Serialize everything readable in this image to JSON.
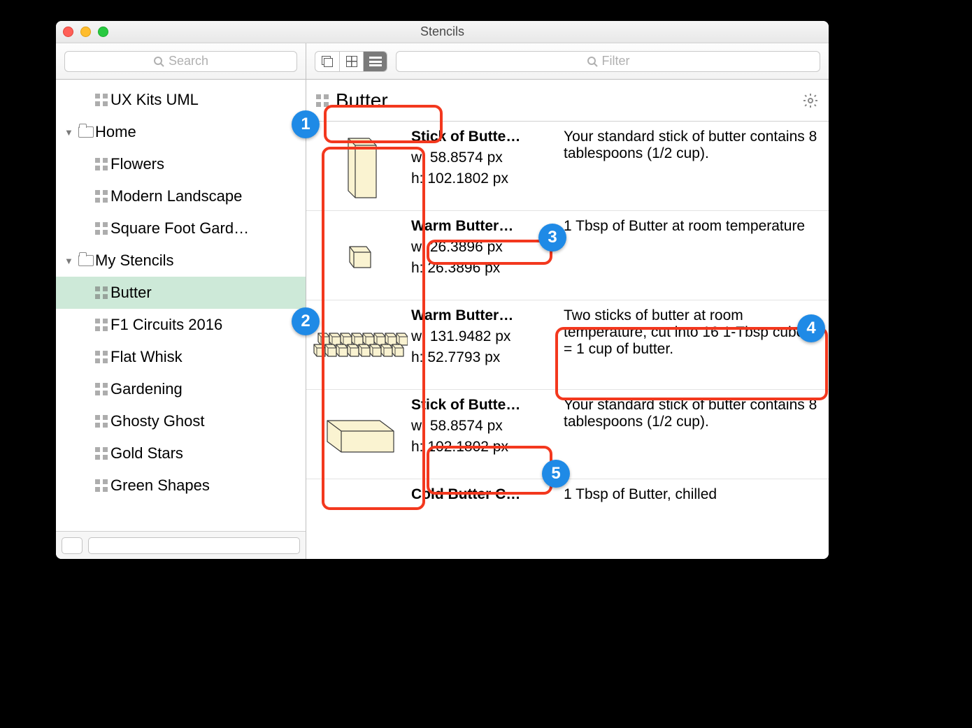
{
  "window": {
    "title": "Stencils"
  },
  "toolbar": {
    "search_placeholder": "Search",
    "filter_placeholder": "Filter"
  },
  "sidebar": {
    "nodes": [
      {
        "label": "UX Kits UML",
        "depth": 2,
        "icon": "grid",
        "selected": false
      },
      {
        "label": "Home",
        "depth": 1,
        "icon": "folder",
        "expanded": true
      },
      {
        "label": "Flowers",
        "depth": 2,
        "icon": "grid"
      },
      {
        "label": "Modern Landscape",
        "depth": 2,
        "icon": "grid"
      },
      {
        "label": "Square Foot Gard…",
        "depth": 2,
        "icon": "grid"
      },
      {
        "label": "My Stencils",
        "depth": 1,
        "icon": "folder",
        "expanded": true
      },
      {
        "label": "Butter",
        "depth": 2,
        "icon": "grid",
        "selected": true
      },
      {
        "label": "F1 Circuits 2016",
        "depth": 2,
        "icon": "grid"
      },
      {
        "label": "Flat Whisk",
        "depth": 2,
        "icon": "grid"
      },
      {
        "label": "Gardening",
        "depth": 2,
        "icon": "grid"
      },
      {
        "label": "Ghosty Ghost",
        "depth": 2,
        "icon": "grid"
      },
      {
        "label": "Gold Stars",
        "depth": 2,
        "icon": "grid"
      },
      {
        "label": "Green Shapes",
        "depth": 2,
        "icon": "grid"
      }
    ]
  },
  "header": {
    "title": "Butter"
  },
  "items": [
    {
      "name": "Stick of Butte…",
      "w": "w: 58.8574 px",
      "h": "h: 102.1802 px",
      "desc": "Your standard stick of butter contains 8 tablespoons (1/2 cup).",
      "thumb": "tall-box"
    },
    {
      "name": "Warm Butter…",
      "w": "w: 26.3896 px",
      "h": "h: 26.3896 px",
      "desc": "1 Tbsp of Butter at room temperature",
      "thumb": "cube"
    },
    {
      "name": "Warm Butter…",
      "w": "w: 131.9482 px",
      "h": "h: 52.7793 px",
      "desc": "Two sticks of butter at room temperature, cut into 16 1-Tbsp cubes = 1 cup of butter.",
      "thumb": "many-cubes"
    },
    {
      "name": "Stick of Butte…",
      "w": "w: 58.8574 px",
      "h": "h: 102.1802 px",
      "desc": "Your standard stick of butter contains 8 tablespoons (1/2 cup).",
      "thumb": "flat-box"
    },
    {
      "name": "Cold Butter C…",
      "w": "",
      "h": "",
      "desc": "1 Tbsp of Butter, chilled",
      "thumb": "none"
    }
  ],
  "callouts": {
    "1": "1",
    "2": "2",
    "3": "3",
    "4": "4",
    "5": "5"
  }
}
